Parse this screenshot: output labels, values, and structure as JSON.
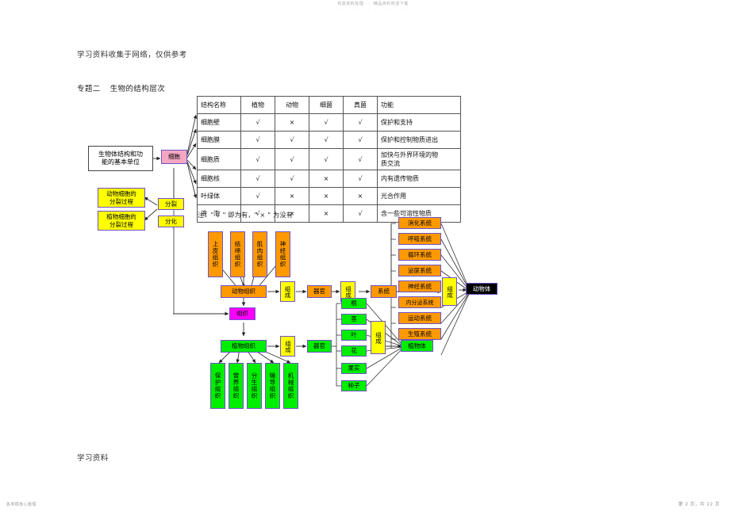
{
  "document": {
    "watermark_top_line1": "有需资料处理 · · ·精品资料欢迎下载",
    "watermark_top_line2": "· · · · · · · · · · · · · ·",
    "header_note": "学习资料收集于网络，仅供参考",
    "topic_label": "专题二",
    "topic_title": "生物的结构层次",
    "footer_left": "学习资料",
    "footer_bottom_left_line1": "各类模板心整理",
    "footer_bottom_left_line2": "· · · · · · ·",
    "footer_page": "第 2 页，共 22 页",
    "footer_page_line2": "· · · · · · · ·"
  },
  "table": {
    "headers": [
      "结构名称",
      "植物",
      "动物",
      "细菌",
      "真菌",
      "功能"
    ],
    "rows": [
      {
        "name": "细胞壁",
        "plant": "√",
        "animal": "×",
        "bacteria": "√",
        "fungi": "√",
        "function": "保护和支持"
      },
      {
        "name": "细胞膜",
        "plant": "√",
        "animal": "√",
        "bacteria": "√",
        "fungi": "√",
        "function": "保护和控制物质进出"
      },
      {
        "name": "细胞质",
        "plant": "√",
        "animal": "√",
        "bacteria": "√",
        "fungi": "√",
        "function_line1": "加快与外界环境的物",
        "function_line2": "质交流"
      },
      {
        "name": "细胞核",
        "plant": "√",
        "animal": "√",
        "bacteria": "×",
        "fungi": "√",
        "function": "内有遗传物质"
      },
      {
        "name": "叶绿体",
        "plant": "√",
        "animal": "×",
        "bacteria": "×",
        "fungi": "×",
        "function": "光合作用"
      },
      {
        "name": "液　泡",
        "plant": "√",
        "animal": "×",
        "bacteria": "×",
        "fungi": "√",
        "function": "含一些可溶性物质"
      }
    ],
    "note": "注：\" √ \" 即为有，\" × \" 为没有"
  },
  "diagram": {
    "unit_box": {
      "line1": "生物体结构和功",
      "line2": "能的基本单位"
    },
    "cell": "细胞",
    "division": "分裂",
    "differentiation": "分化",
    "animal_cell_division": {
      "line1": "动物细胞的",
      "line2": "分裂过程"
    },
    "plant_cell_division": {
      "line1": "植物细胞的",
      "line2": "分裂过程"
    },
    "tissue_node": "组织",
    "animal_tissues": [
      "上皮组织",
      "结缔组织",
      "肌肉组织",
      "神经组织"
    ],
    "animal_tissue_group": "动物组织",
    "plant_tissues": [
      "保护组织",
      "营养组织",
      "分生组织",
      "输导组织",
      "机械组织"
    ],
    "plant_tissue_group": "植物组织",
    "compose_label": "组成",
    "animal_organ": "器官",
    "plant_organ": "器官",
    "plant_organs": [
      "根",
      "茎",
      "叶",
      "花",
      "果实",
      "种子"
    ],
    "system_label": "系统",
    "animal_systems": [
      "消化系统",
      "呼吸系统",
      "循环系统",
      "泌尿系统",
      "神经系统",
      "内分泌系统",
      "运动系统",
      "生殖系统"
    ],
    "animal_body": "动物体",
    "plant_body": "植物体"
  },
  "colors": {
    "pink": "#f4a7c3",
    "yellow": "#ffff00",
    "orange": "#ff9900",
    "green": "#00ee00",
    "magenta": "#ff00ff",
    "black": "#000000",
    "border_purple": "#6f52c9"
  }
}
